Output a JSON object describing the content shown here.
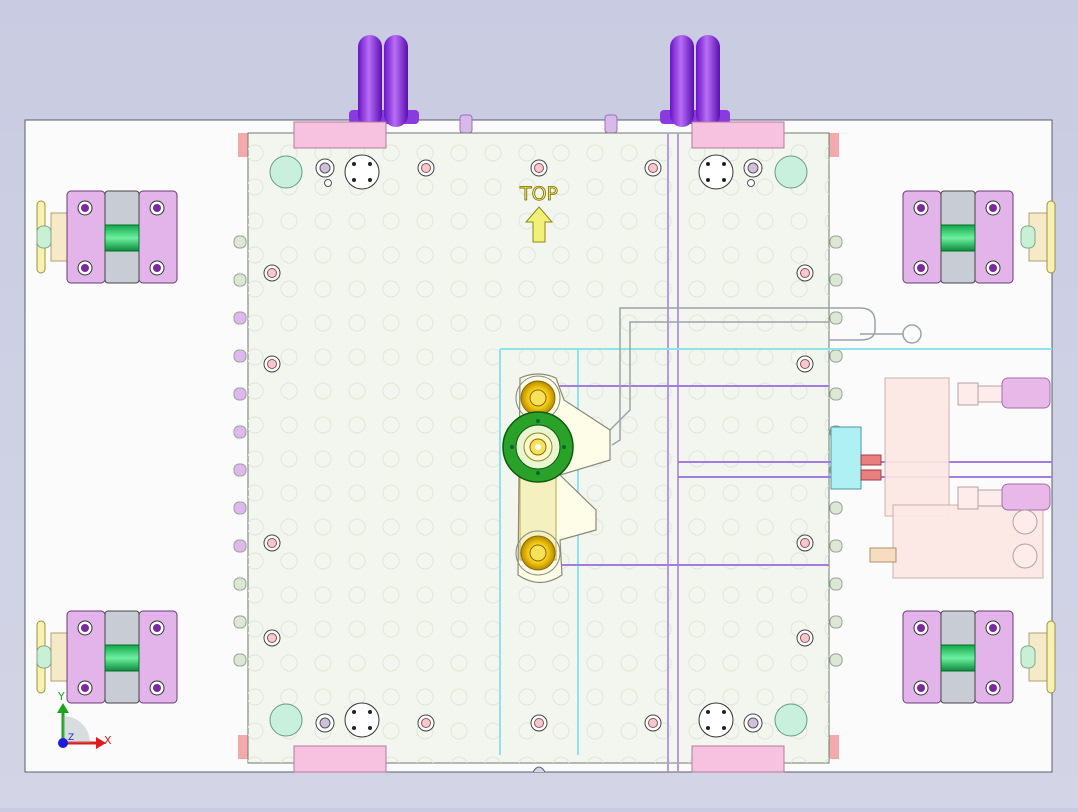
{
  "viewport": {
    "background_top": "#c9cbe2",
    "background_bottom": "#d3d5e6"
  },
  "drawing": {
    "orientation_label": "TOP",
    "orientation_icon": "up-arrow-icon",
    "colors": {
      "plate": "#f3f6ee",
      "plate_border": "#6f7a6a",
      "frame": "#fbfbfc",
      "clamp_purple": "#e2b4ea",
      "clamp_core": "#2ad36c",
      "hose": "#8b2be0",
      "sprue_ring": "#2a9a2a",
      "gate_yellow": "#f2c400",
      "water_cyan": "#8fe3ea",
      "water_violet": "#a27ce0",
      "arrow_yellow": "#f3f07a",
      "pin_pink": "#f7c9cf"
    }
  },
  "triad": {
    "x_label": "X",
    "y_label": "Y",
    "z_label": "Z",
    "x_color": "#e01b1b",
    "y_color": "#1aa51a",
    "z_color": "#1a1ae0"
  }
}
